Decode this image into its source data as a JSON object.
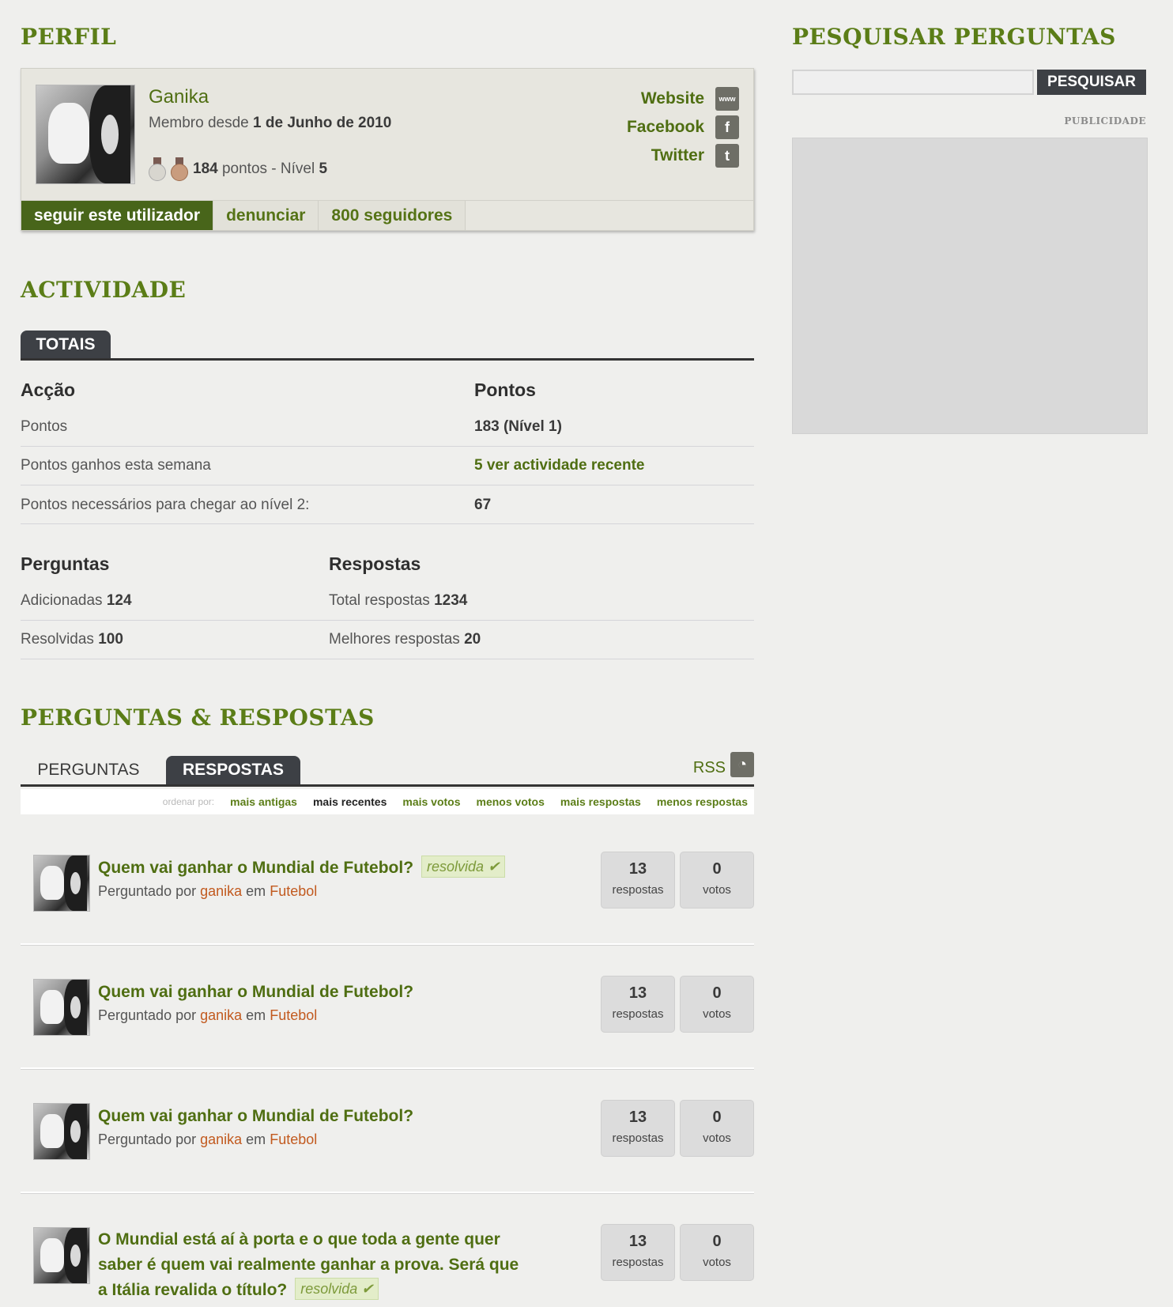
{
  "profile": {
    "title": "PERFIL",
    "name": "Ganika",
    "member_since_prefix": "Membro desde",
    "member_since_date": "1 de Junho de 2010",
    "points_value": "184",
    "points_suffix": "pontos - Nível",
    "level": "5",
    "links": [
      {
        "label": "Website",
        "icon": "www-icon"
      },
      {
        "label": "Facebook",
        "icon": "facebook-icon"
      },
      {
        "label": "Twitter",
        "icon": "twitter-icon"
      }
    ],
    "actions": {
      "follow": "seguir este utilizador",
      "report": "denunciar",
      "followers": "800 seguidores"
    }
  },
  "activity": {
    "title": "ACTIVIDADE",
    "tab": "TOTAIS",
    "col_action": "Acção",
    "col_points": "Pontos",
    "rows": [
      {
        "label": "Pontos",
        "value": "183 (Nível 1)"
      },
      {
        "label": "Pontos ganhos esta semana",
        "value": "5 ver actividade recente"
      },
      {
        "label": "Pontos necessários para chegar ao nível 2:",
        "value": "67"
      }
    ],
    "questions_head": "Perguntas",
    "answers_head": "Respostas",
    "questions": [
      {
        "label": "Adicionadas",
        "value": "124"
      },
      {
        "label": "Resolvidas",
        "value": "100"
      }
    ],
    "answers": [
      {
        "label": "Total respostas",
        "value": "1234"
      },
      {
        "label": "Melhores respostas",
        "value": "20"
      }
    ]
  },
  "qa": {
    "title": "PERGUNTAS & RESPOSTAS",
    "tab_questions": "PERGUNTAS",
    "tab_answers": "RESPOSTAS",
    "rss": "RSS",
    "sort_label": "ordenar por:",
    "sort_options": [
      "mais antigas",
      "mais recentes",
      "mais votos",
      "menos votos",
      "mais respostas",
      "menos respostas"
    ],
    "items": [
      {
        "title": "Quem vai ganhar o Mundial de Futebol?",
        "solved": "resolvida",
        "asked_by": "Perguntado por",
        "user": "ganika",
        "in": "em",
        "category": "Futebol",
        "answers": "13",
        "answers_label": "respostas",
        "votes": "0",
        "votes_label": "votos"
      },
      {
        "title": "Quem vai ganhar o Mundial de Futebol?",
        "solved": "",
        "asked_by": "Perguntado por",
        "user": "ganika",
        "in": "em",
        "category": "Futebol",
        "answers": "13",
        "answers_label": "respostas",
        "votes": "0",
        "votes_label": "votos"
      },
      {
        "title": "Quem vai ganhar o Mundial de Futebol?",
        "solved": "",
        "asked_by": "Perguntado por",
        "user": "ganika",
        "in": "em",
        "category": "Futebol",
        "answers": "13",
        "answers_label": "respostas",
        "votes": "0",
        "votes_label": "votos"
      },
      {
        "title_line1": "O Mundial está aí à porta e o que toda a gente quer",
        "title_line2": "saber é quem vai realmente ganhar a prova. Será que",
        "title_line3": "a Itália revalida o título?",
        "solved": "resolvida",
        "answers": "13",
        "answers_label": "respostas",
        "votes": "0",
        "votes_label": "votos"
      }
    ]
  },
  "sidebar": {
    "search_title": "PESQUISAR PERGUNTAS",
    "search_button": "PESQUISAR",
    "search_value": "",
    "ad_label": "PUBLICIDADE"
  }
}
